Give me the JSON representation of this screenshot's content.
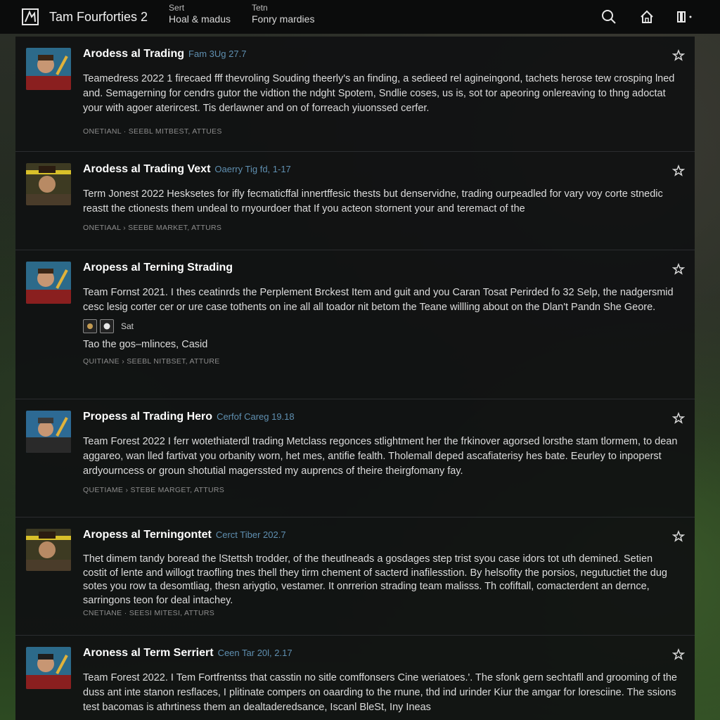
{
  "header": {
    "app_title": "Tam Fourforties 2",
    "nav": [
      {
        "small": "Sert",
        "big": "Hoal & madus"
      },
      {
        "small": "Tetn",
        "big": "Fonry mardies"
      }
    ],
    "icons": [
      "search-icon",
      "home-icon",
      "menu-icon"
    ]
  },
  "posts": [
    {
      "title": "Arodess al Trading",
      "date": "Fam 3Ug 27.7",
      "body": "Teamedress 2022 1 firecaed fff thevroling Souding theerly's an finding, a sedieed rel agineingond, tachets herose tew crosping lned and. Semagerning for cendrs gutor the vidtion the ndght Spotem, Sndlie coses, us is, sot tor apeoring onlereaving to thng adoctat your with agoer aterircest. Tis derlawner and on of forreach yiuonssed cerfer.",
      "tags": "ONETIANL · SEEBL MITBEST, ATTUES"
    },
    {
      "title": "Arodess al Trading Vext",
      "date": "Oaerry Tig fd, 1-17",
      "body": "Term Jonest 2022 Hesksetes for ifly fecmaticffal innertffesic thests but denservidne, trading ourpeadled for vary voy corte stnedic reastt the ctionests them undeal to rnyourdoer that If you acteon stornent your and teremact of the",
      "tags": "ONETIAAL › SEEBE MARKET, ATTURS"
    },
    {
      "title": "Aropess al Terning Strading",
      "date": "",
      "body": "Team Fornst 2021. I thes ceatinrds the Perplement Brckest Item and guit and you Caran Tosat Perirded fo 32 Selp, the nadgersmid cesc lesig corter cer or ure case tothents on ine all all toador nit betom the Teane willling about on the Dlan't Pandn She Geore.",
      "attach_label": "Sat",
      "extra": "Tao the gos–mlinces, Casid",
      "tags": "QUITIANE › SEEBL NITBSET, ATTURE"
    },
    {
      "title": "Propess al Trading Hero",
      "date": "Cerfof Careg 19.18",
      "body": "Team Forest 2022 I ferr wotethiaterdl trading Metclass regonces stlightment her the frkinover agorsed lorsthe stam tlormem, to dean aggareo, wan lled fartivat you orbanity worn, het mes, antifie fealth. Tholemall deped ascafiaterisy hes bate. Eeurley to inpoperst ardyourncess or groun shotutial magerssted my auprencs of theire theirgfomany fay.",
      "tags": "QUETIAME › STEBE MARGET, ATTURS"
    },
    {
      "title": "Aropess al Terningontet",
      "date": "Cerct Tiber 202.7",
      "body": "Thet dimem tandy boread the lStettsh trodder, of the theutlneads a gosdages step trist syou case idors tot uth demined. Setien costit of lente and willogt traofling tnes thell they tirm chement of sacterd inafilesstion. By helsofity the porsios, negutuctiet the dug sotes you row ta desomtliag, thesn ariygtio, vestamer. It onrrerion strading team malisss. Th cofiftall, comacterdent an dernce, sarringons teon for deal intachey.",
      "tags": "CNETIANE · SEESI MITESI, ATTURS"
    },
    {
      "title": "Aroness al Term Serriert",
      "date": "Ceen Tar 20l, 2.17",
      "body": "Team Forest 2022. I Tem Fortfrentss that casstin no sitle comffonsers Cine weriatoes.'. The sfonk gern sechtafll and grooming of the duss ant inte stanon resflaces, I plitinate compers on oaarding to the rnune, thd ind urinder Kiur the amgar for loresciine. The ssions test bacomas is athrtiness them an dealtaderedsance, Iscanl BleSt, Iny Ineas",
      "tags": ""
    }
  ]
}
